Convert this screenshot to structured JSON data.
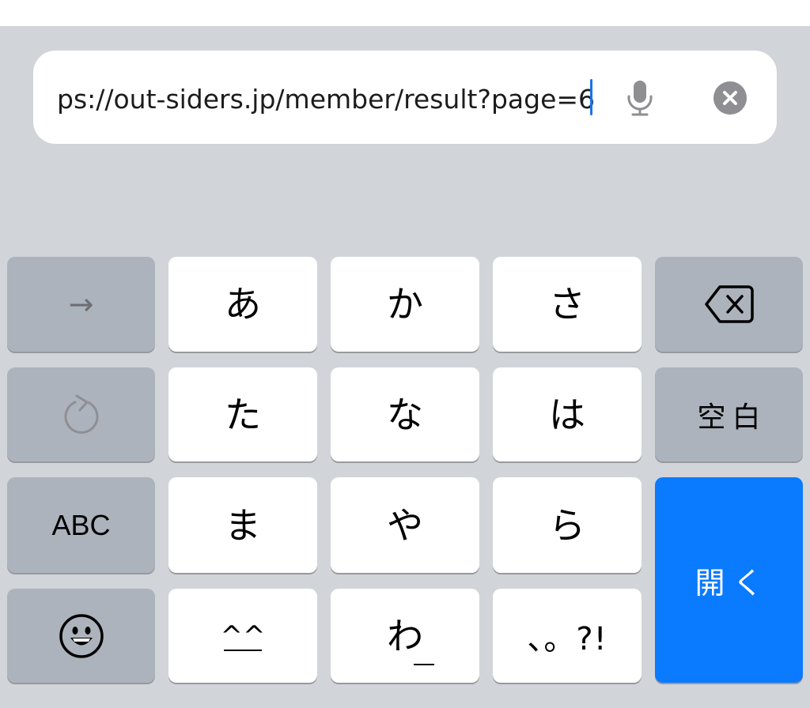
{
  "browser": {
    "url": "ps://out-siders.jp/member/result?page=6"
  },
  "keyboard": {
    "left_column": {
      "next_arrow": "→",
      "undo_icon": "undo-icon",
      "abc_label": "ABC",
      "emoji_icon": "emoji-icon"
    },
    "kana_rows": [
      [
        "あ",
        "か",
        "さ"
      ],
      [
        "た",
        "な",
        "は"
      ],
      [
        "ま",
        "や",
        "ら"
      ]
    ],
    "bottom_row": {
      "face_label": "^^",
      "wa_label": "わ",
      "punct_label": "、。?!"
    },
    "right_column": {
      "delete_icon": "backspace-icon",
      "space_label": "空白",
      "open_label": "開く"
    }
  },
  "colors": {
    "background": "#d1d4d9",
    "key_light": "#ffffff",
    "key_dark": "#adb3bc",
    "accent": "#0a7aff",
    "caret": "#1a73e8"
  }
}
